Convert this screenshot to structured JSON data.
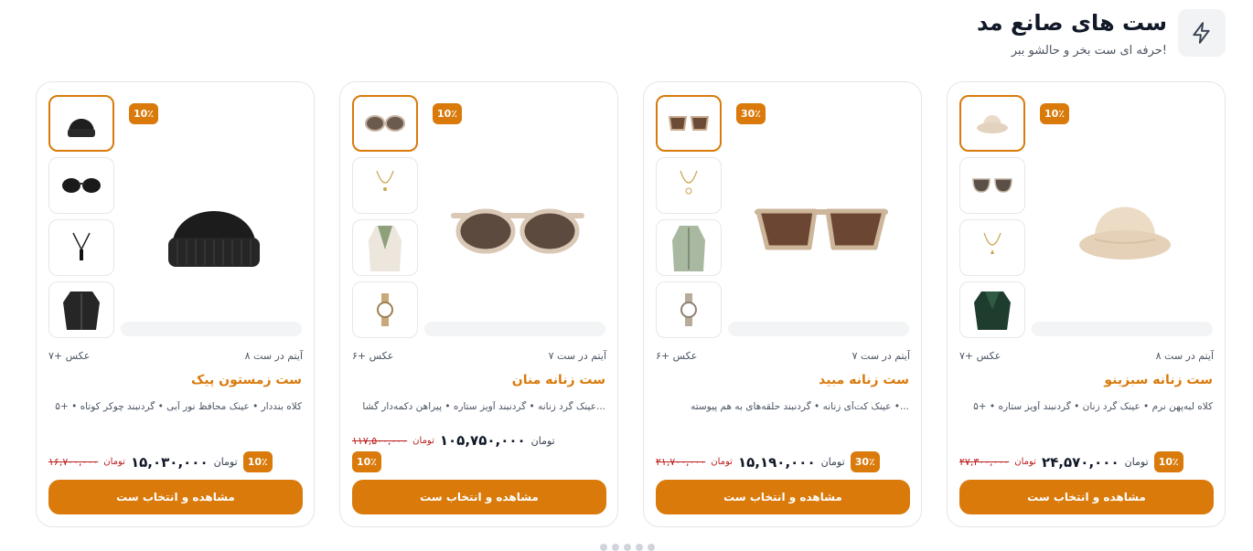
{
  "header": {
    "title": "ست های صانع مد",
    "subtitle": "حرفه ای ست بخر و حالشو ببر!",
    "icon": "lightning-icon"
  },
  "currency": "تومان",
  "cta_label": "مشاهده و انتخاب ست",
  "cards": [
    {
      "name": "ست زمستون پیک",
      "items_count": "۸ آیتم در ست",
      "photos": "۷+ عکس",
      "discount": "10٪",
      "description": "کلاه بنددار • عینک محافظ نور آبی • گردنبند چوکر کوتاه • +۵",
      "old_price": "۱۶,۷۰۰,۰۰۰",
      "price": "۱۵,۰۳۰,۰۰۰",
      "hero": "beanie",
      "thumbs": [
        "beanie",
        "sunglasses-dark",
        "necklace-pendant",
        "jacket"
      ]
    },
    {
      "name": "ست زنانه منان",
      "items_count": "۷ آیتم در ست",
      "photos": "۶+ عکس",
      "discount": "10٪",
      "description": "عینک گرد زنانه • گردنبند آویز ستاره • پیراهن دکمه‌دار گشا...",
      "old_price": "۱۱۷,۵۰۰,۰۰۰",
      "price": "۱۰۵,۷۵۰,۰۰۰",
      "hero": "sunglasses-round",
      "thumbs": [
        "sunglasses-round",
        "necklace-chain",
        "coat-light",
        "watch"
      ]
    },
    {
      "name": "ست زنانه مبید",
      "items_count": "۷ آیتم در ست",
      "photos": "۶+ عکس",
      "discount": "30٪",
      "description": "عینک کت‌آی زنانه • گردنبند حلقه‌های به هم پیوسته •...",
      "old_price": "۲۱,۷۰۰,۰۰۰",
      "price": "۱۵,۱۹۰,۰۰۰",
      "hero": "sunglasses-cateye",
      "thumbs": [
        "sunglasses-cateye",
        "necklace-chain",
        "coat-sage",
        "watch"
      ]
    },
    {
      "name": "ست زنانه سبزینو",
      "items_count": "۸ آیتم در ست",
      "photos": "۷+ عکس",
      "discount": "10٪",
      "description": "کلاه لبه‌پهن نرم • عینک گرد زنان • گردنبند آویز ستاره • +۵",
      "old_price": "۲۷,۳۰۰,۰۰۰",
      "price": "۲۴,۵۷۰,۰۰۰",
      "hero": "bucket-hat",
      "thumbs": [
        "bucket-hat",
        "sunglasses-aviator",
        "necklace-chain",
        "jacket-green"
      ]
    }
  ],
  "colors": {
    "accent": "#d97a0b",
    "old_price": "#b91c1c"
  }
}
